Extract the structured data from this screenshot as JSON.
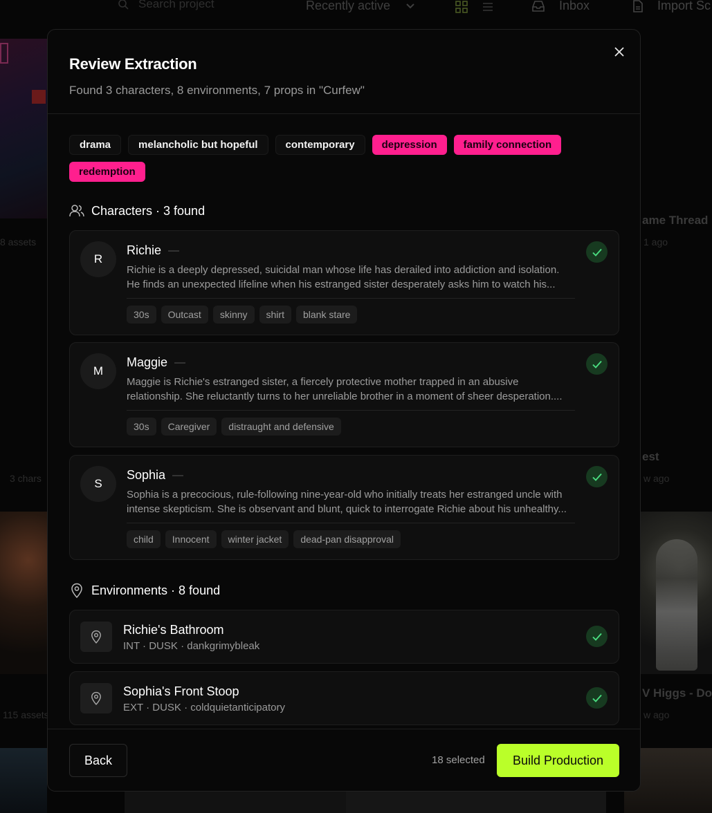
{
  "background": {
    "search_placeholder": "Search project",
    "sort_label": "Recently active",
    "inbox_label": "Inbox",
    "import_label": "Import Sc",
    "card_titles": [
      "ame Thread",
      "est",
      "V Higgs - Doj"
    ],
    "card_subs": [
      "8 assets",
      "3 chars",
      "115 assets",
      "1 ago",
      "w ago",
      "w ago"
    ]
  },
  "modal": {
    "title": "Review Extraction",
    "subtitle": "Found 3 characters, 8 environments, 7 props in \"Curfew\"",
    "tags": [
      {
        "label": "drama",
        "highlight": false
      },
      {
        "label": "melancholic but hopeful",
        "highlight": false
      },
      {
        "label": "contemporary",
        "highlight": false
      },
      {
        "label": "depression",
        "highlight": true
      },
      {
        "label": "family connection",
        "highlight": true
      },
      {
        "label": "redemption",
        "highlight": true
      }
    ],
    "characters_heading": "Characters · 3 found",
    "characters": [
      {
        "initial": "R",
        "name": "Richie",
        "description": "Richie is a deeply depressed, suicidal man whose life has derailed into addiction and isolation. He finds an unexpected lifeline when his estranged sister desperately asks him to watch his...",
        "traits": [
          "30s",
          "Outcast",
          "skinny",
          "shirt",
          "blank stare"
        ],
        "selected": true
      },
      {
        "initial": "M",
        "name": "Maggie",
        "description": "Maggie is Richie's estranged sister, a fiercely protective mother trapped in an abusive relationship. She reluctantly turns to her unreliable brother in a moment of sheer desperation....",
        "traits": [
          "30s",
          "Caregiver",
          "distraught and defensive"
        ],
        "selected": true
      },
      {
        "initial": "S",
        "name": "Sophia",
        "description": "Sophia is a precocious, rule-following nine-year-old who initially treats her estranged uncle with intense skepticism. She is observant and blunt, quick to interrogate Richie about his unhealthy...",
        "traits": [
          "child",
          "Innocent",
          "winter jacket",
          "dead-pan disapproval"
        ],
        "selected": true
      }
    ],
    "environments_heading": "Environments · 8 found",
    "environments": [
      {
        "name": "Richie's Bathroom",
        "meta": "INT · DUSK · dankgrimybleak",
        "selected": true
      },
      {
        "name": "Sophia's Front Stoop",
        "meta": "EXT · DUSK · coldquietanticipatory",
        "selected": true
      }
    ],
    "footer": {
      "back_label": "Back",
      "selected_label": "18 selected",
      "build_label": "Build Production"
    }
  },
  "colors": {
    "accent": "#baff29",
    "tag_highlight": "#ff1f8e",
    "check_bg": "#173a20",
    "check_mark": "#4ade80"
  }
}
